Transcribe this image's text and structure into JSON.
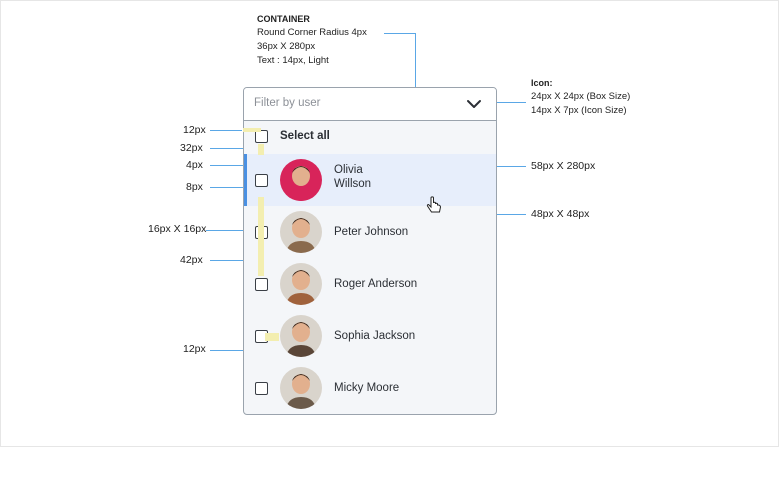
{
  "spec": {
    "container_heading": "CONTAINER",
    "container_lines": [
      "Round Corner Radius 4px",
      "36px X 280px",
      "Text : 14px, Light"
    ],
    "icon_heading": "Icon:",
    "icon_lines": [
      "24px X 24px (Box Size)",
      "14px X 7px (Icon Size)"
    ],
    "row_size": "58px X 280px",
    "avatar_size": "48px X 48px",
    "left_labels": [
      "12px",
      "32px",
      "4px",
      "8px",
      "16px X 16px",
      "42px",
      "12px"
    ]
  },
  "dropdown": {
    "placeholder": "Filter by user",
    "select_all": "Select all",
    "users": [
      {
        "first": "Olivia",
        "last": "Willson",
        "hover": true,
        "color": "#d8245a"
      },
      {
        "first": "Peter Johnson",
        "last": "",
        "hover": false,
        "color": "#8a6a4d"
      },
      {
        "first": "Roger Anderson",
        "last": "",
        "hover": false,
        "color": "#a0623c"
      },
      {
        "first": "Sophia Jackson",
        "last": "",
        "hover": false,
        "color": "#5a4638"
      },
      {
        "first": "Micky Moore",
        "last": "",
        "hover": false,
        "color": "#6b5a4a"
      }
    ],
    "accent": "#4a90e2",
    "hover_bg": "#e7eefb"
  }
}
